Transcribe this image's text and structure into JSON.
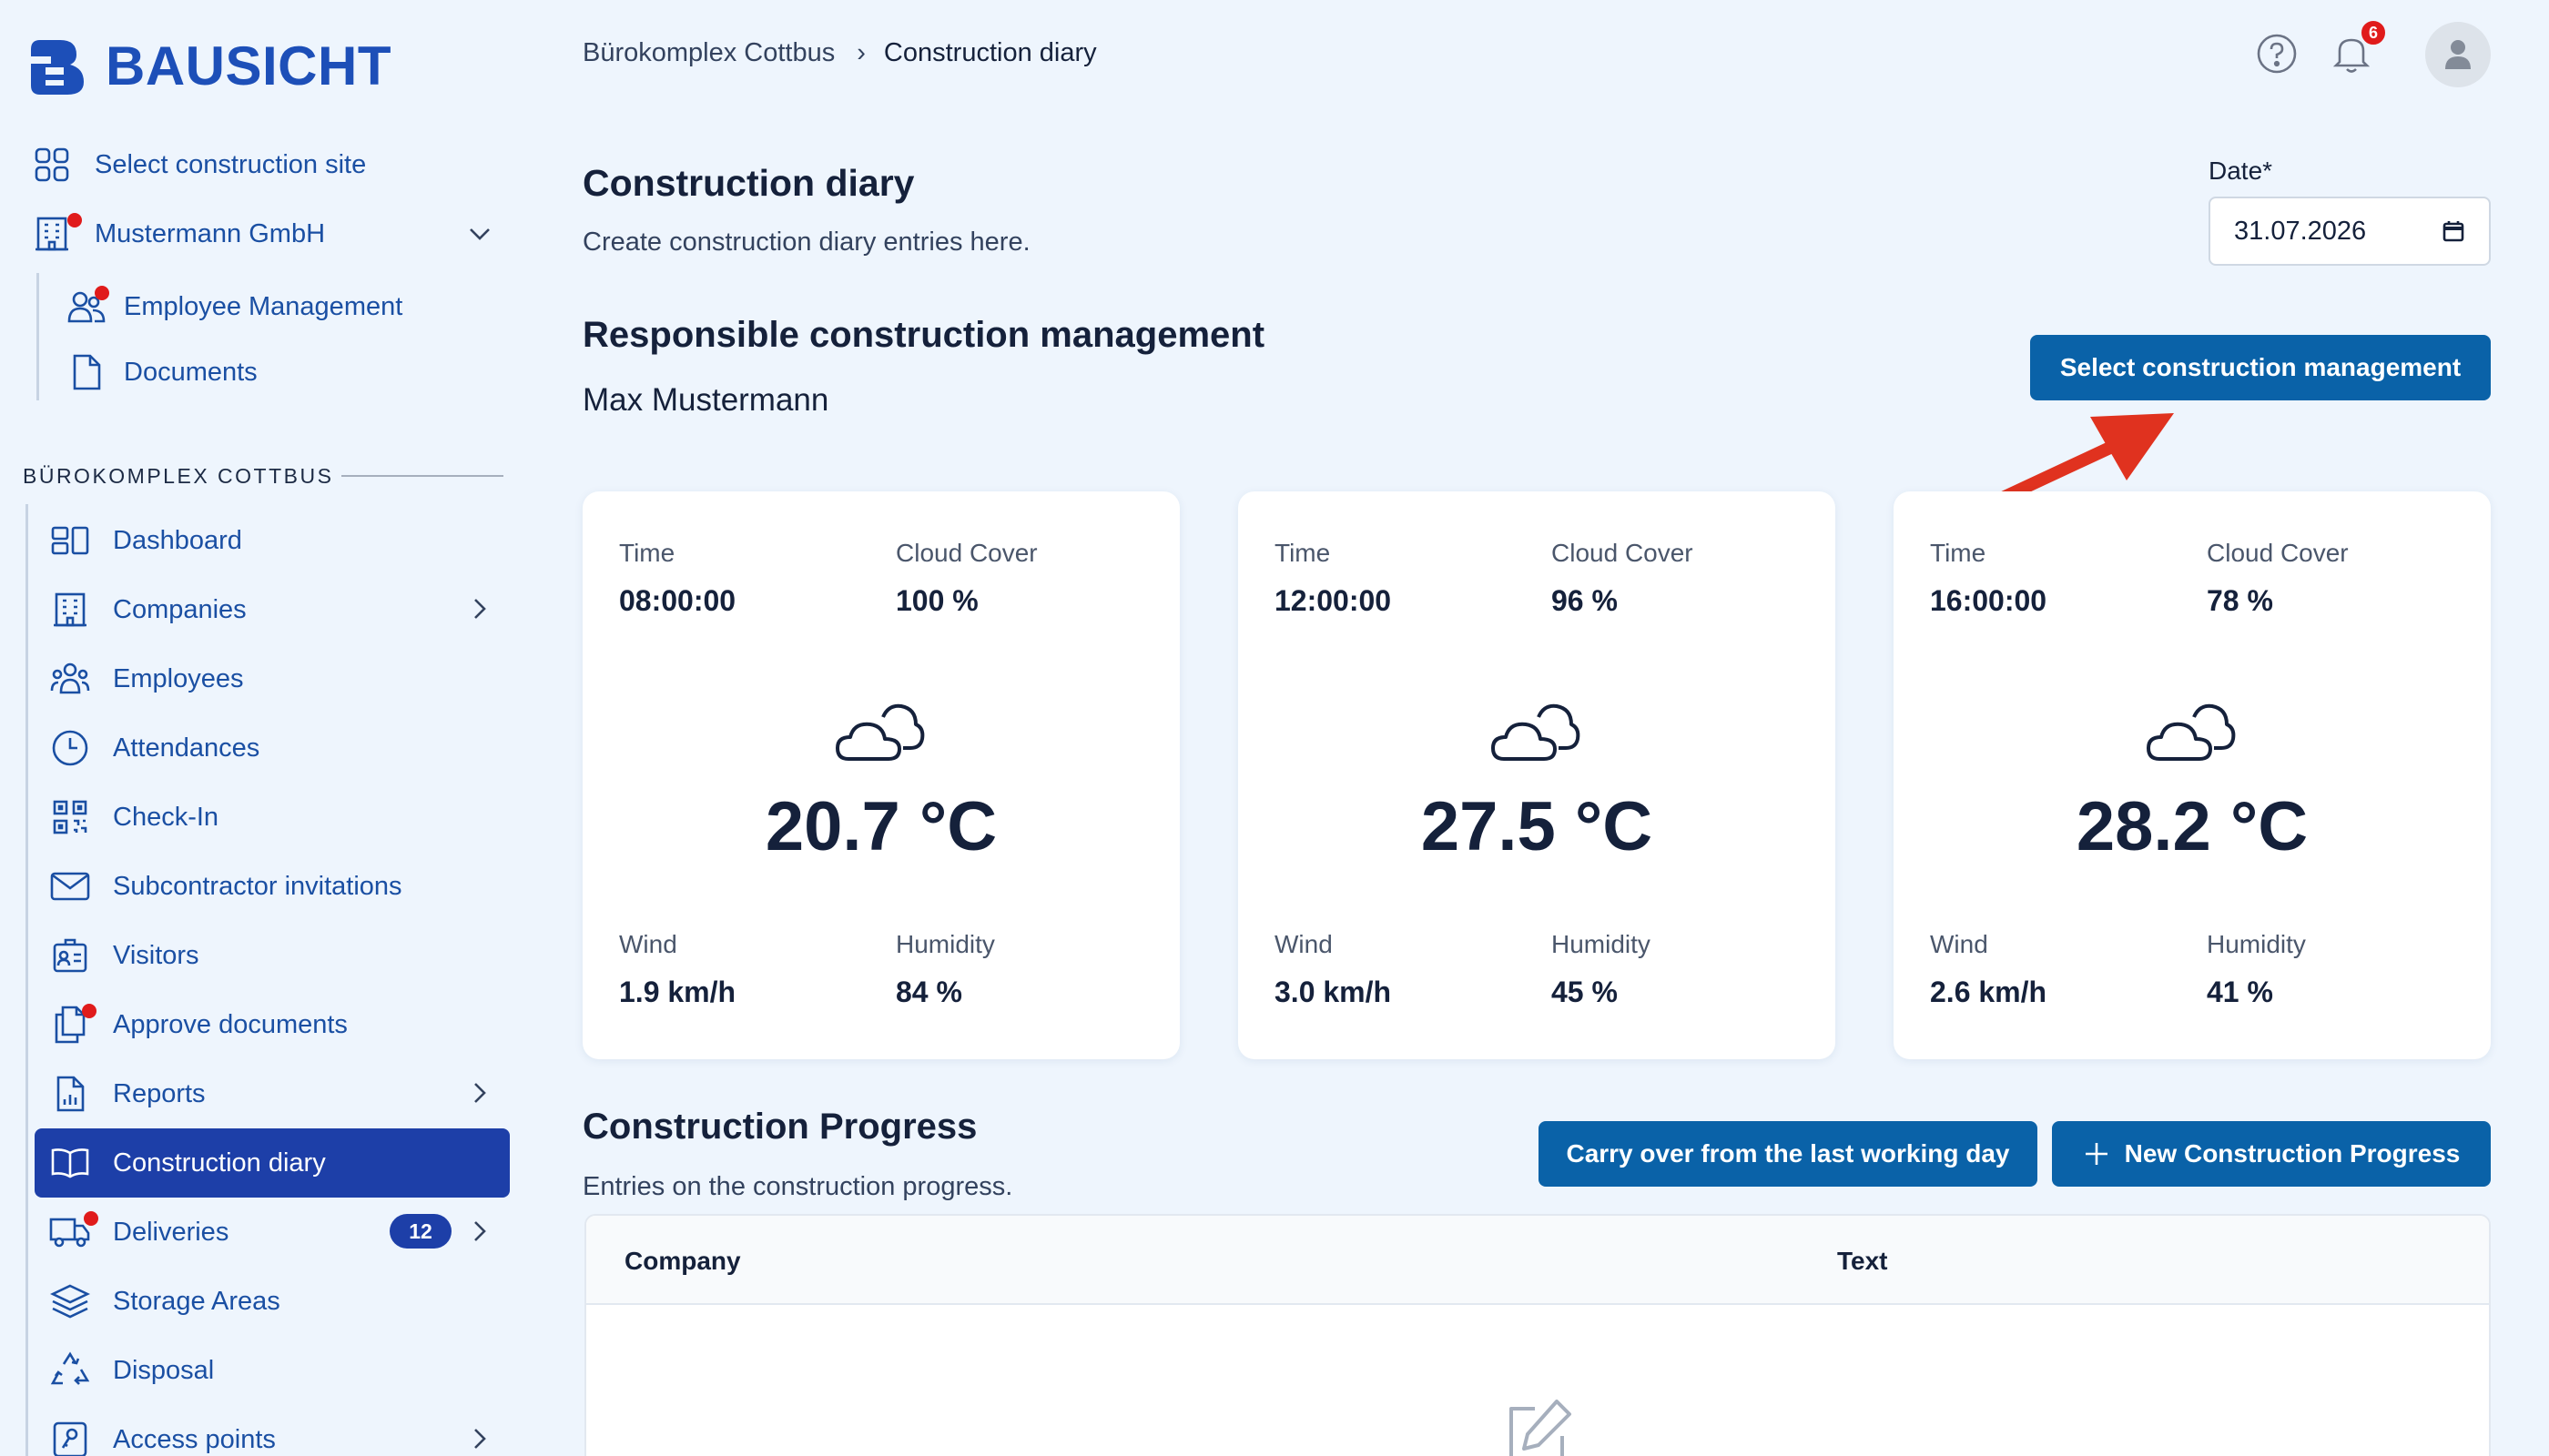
{
  "app": {
    "brand": "BAUSICHT"
  },
  "sidebar": {
    "select_site": "Select construction site",
    "company": "Mustermann GmbH",
    "company_children": [
      "Employee Management",
      "Documents"
    ],
    "section_title": "BÜROKOMPLEX COTTBUS",
    "items": [
      {
        "label": "Dashboard",
        "icon": "dashboard-icon"
      },
      {
        "label": "Companies",
        "icon": "building-icon"
      },
      {
        "label": "Employees",
        "icon": "users-icon"
      },
      {
        "label": "Attendances",
        "icon": "clock-icon"
      },
      {
        "label": "Check-In",
        "icon": "qr-code-icon"
      },
      {
        "label": "Subcontractor invitations",
        "icon": "envelope-icon"
      },
      {
        "label": "Visitors",
        "icon": "id-badge-icon"
      },
      {
        "label": "Approve documents",
        "icon": "documents-icon"
      },
      {
        "label": "Reports",
        "icon": "report-icon"
      },
      {
        "label": "Construction diary",
        "icon": "book-icon"
      },
      {
        "label": "Deliveries",
        "icon": "truck-icon",
        "badge": "12"
      },
      {
        "label": "Storage Areas",
        "icon": "layers-icon"
      },
      {
        "label": "Disposal",
        "icon": "recycle-icon"
      },
      {
        "label": "Access points",
        "icon": "key-icon"
      }
    ],
    "active_item": "Construction diary"
  },
  "header": {
    "breadcrumb": [
      "Bürokomplex Cottbus",
      "Construction diary"
    ],
    "breadcrumb_sep": "›",
    "notification_count": "6"
  },
  "main": {
    "title": "Construction diary",
    "subtitle": "Create construction diary entries here.",
    "date_label": "Date*",
    "date_value": "31.07.2026",
    "responsible_title": "Responsible construction management",
    "responsible_name": "Max Mustermann",
    "select_button": "Select construction management",
    "weather": [
      {
        "time_label": "Time",
        "time": "08:00:00",
        "cloud_label": "Cloud Cover",
        "cloud": "100 %",
        "temp": "20.7 °C",
        "wind_label": "Wind",
        "wind": "1.9 km/h",
        "humidity_label": "Humidity",
        "humidity": "84 %"
      },
      {
        "time_label": "Time",
        "time": "12:00:00",
        "cloud_label": "Cloud Cover",
        "cloud": "96 %",
        "temp": "27.5 °C",
        "wind_label": "Wind",
        "wind": "3.0 km/h",
        "humidity_label": "Humidity",
        "humidity": "45 %"
      },
      {
        "time_label": "Time",
        "time": "16:00:00",
        "cloud_label": "Cloud Cover",
        "cloud": "78 %",
        "temp": "28.2 °C",
        "wind_label": "Wind",
        "wind": "2.6 km/h",
        "humidity_label": "Humidity",
        "humidity": "41 %"
      }
    ],
    "progress": {
      "title": "Construction Progress",
      "subtitle": "Entries on the construction progress.",
      "carry_over_button": "Carry over from the last working day",
      "new_button": "New Construction Progress",
      "columns": [
        "Company",
        "Text"
      ]
    }
  },
  "colors": {
    "accent": "#0a62a8",
    "active_nav": "#1d3fa8",
    "nav_text": "#1a4fa3",
    "alert": "#e01b1b",
    "annotation_arrow": "#e0321f"
  }
}
